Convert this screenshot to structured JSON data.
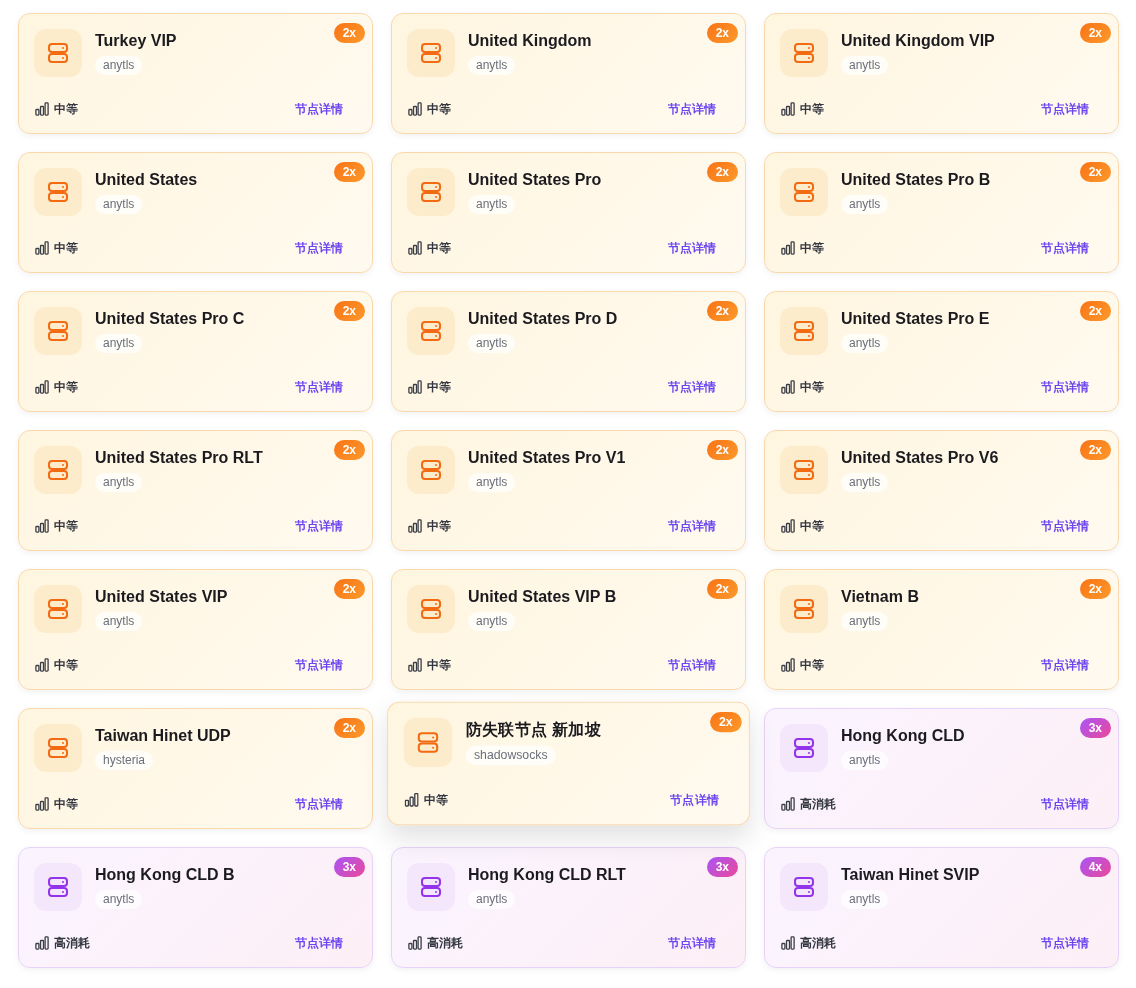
{
  "nodes": [
    {
      "name": "Turkey VIP",
      "protocol": "anytls",
      "multiplier": "2x",
      "load": "中等",
      "kind": "medium",
      "link": "节点详情",
      "hovered": false
    },
    {
      "name": "United Kingdom",
      "protocol": "anytls",
      "multiplier": "2x",
      "load": "中等",
      "kind": "medium",
      "link": "节点详情",
      "hovered": false
    },
    {
      "name": "United Kingdom VIP",
      "protocol": "anytls",
      "multiplier": "2x",
      "load": "中等",
      "kind": "medium",
      "link": "节点详情",
      "hovered": false
    },
    {
      "name": "United States",
      "protocol": "anytls",
      "multiplier": "2x",
      "load": "中等",
      "kind": "medium",
      "link": "节点详情",
      "hovered": false
    },
    {
      "name": "United States Pro",
      "protocol": "anytls",
      "multiplier": "2x",
      "load": "中等",
      "kind": "medium",
      "link": "节点详情",
      "hovered": false
    },
    {
      "name": "United States Pro B",
      "protocol": "anytls",
      "multiplier": "2x",
      "load": "中等",
      "kind": "medium",
      "link": "节点详情",
      "hovered": false
    },
    {
      "name": "United States Pro C",
      "protocol": "anytls",
      "multiplier": "2x",
      "load": "中等",
      "kind": "medium",
      "link": "节点详情",
      "hovered": false
    },
    {
      "name": "United States Pro D",
      "protocol": "anytls",
      "multiplier": "2x",
      "load": "中等",
      "kind": "medium",
      "link": "节点详情",
      "hovered": false
    },
    {
      "name": "United States Pro E",
      "protocol": "anytls",
      "multiplier": "2x",
      "load": "中等",
      "kind": "medium",
      "link": "节点详情",
      "hovered": false
    },
    {
      "name": "United States Pro RLT",
      "protocol": "anytls",
      "multiplier": "2x",
      "load": "中等",
      "kind": "medium",
      "link": "节点详情",
      "hovered": false
    },
    {
      "name": "United States Pro V1",
      "protocol": "anytls",
      "multiplier": "2x",
      "load": "中等",
      "kind": "medium",
      "link": "节点详情",
      "hovered": false
    },
    {
      "name": "United States Pro V6",
      "protocol": "anytls",
      "multiplier": "2x",
      "load": "中等",
      "kind": "medium",
      "link": "节点详情",
      "hovered": false
    },
    {
      "name": "United States VIP",
      "protocol": "anytls",
      "multiplier": "2x",
      "load": "中等",
      "kind": "medium",
      "link": "节点详情",
      "hovered": false
    },
    {
      "name": "United States VIP B",
      "protocol": "anytls",
      "multiplier": "2x",
      "load": "中等",
      "kind": "medium",
      "link": "节点详情",
      "hovered": false
    },
    {
      "name": "Vietnam B",
      "protocol": "anytls",
      "multiplier": "2x",
      "load": "中等",
      "kind": "medium",
      "link": "节点详情",
      "hovered": false
    },
    {
      "name": "Taiwan Hinet UDP",
      "protocol": "hysteria",
      "multiplier": "2x",
      "load": "中等",
      "kind": "medium",
      "link": "节点详情",
      "hovered": false
    },
    {
      "name": "防失联节点 新加坡",
      "protocol": "shadowsocks",
      "multiplier": "2x",
      "load": "中等",
      "kind": "medium",
      "link": "节点详情",
      "hovered": true
    },
    {
      "name": "Hong Kong CLD",
      "protocol": "anytls",
      "multiplier": "3x",
      "load": "高消耗",
      "kind": "high",
      "link": "节点详情",
      "hovered": false
    },
    {
      "name": "Hong Kong CLD B",
      "protocol": "anytls",
      "multiplier": "3x",
      "load": "高消耗",
      "kind": "high",
      "link": "节点详情",
      "hovered": false
    },
    {
      "name": "Hong Kong CLD RLT",
      "protocol": "anytls",
      "multiplier": "3x",
      "load": "高消耗",
      "kind": "high",
      "link": "节点详情",
      "hovered": false
    },
    {
      "name": "Taiwan Hinet SVIP",
      "protocol": "anytls",
      "multiplier": "4x",
      "load": "高消耗",
      "kind": "high",
      "link": "节点详情",
      "hovered": false
    }
  ]
}
